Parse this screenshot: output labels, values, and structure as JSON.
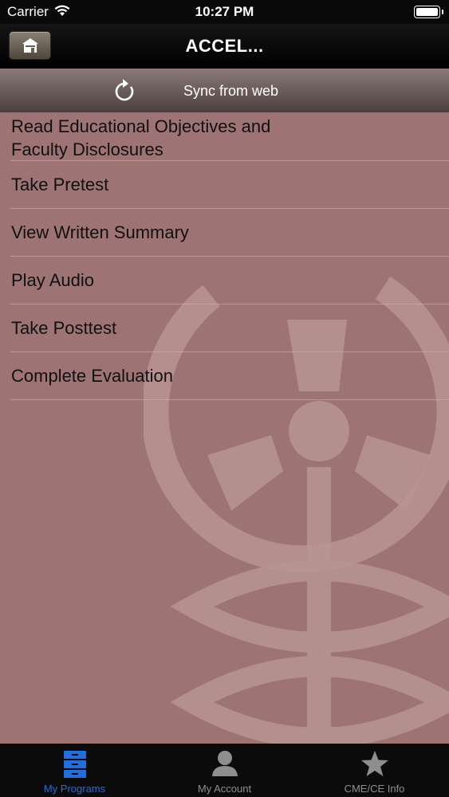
{
  "status_bar": {
    "carrier": "Carrier",
    "time": "10:27 PM"
  },
  "nav": {
    "title": "ACCEL...",
    "home_icon": "home-icon"
  },
  "sync": {
    "label": "Sync from web",
    "icon": "refresh-icon"
  },
  "menu": {
    "items": [
      {
        "label": "Read Educational Objectives and Faculty Disclosures"
      },
      {
        "label": "Take Pretest"
      },
      {
        "label": "View Written Summary"
      },
      {
        "label": "Play Audio"
      },
      {
        "label": "Take Posttest"
      },
      {
        "label": "Complete Evaluation"
      }
    ]
  },
  "tabs": [
    {
      "label": "My Programs",
      "icon": "cabinet-icon",
      "active": true
    },
    {
      "label": "My Account",
      "icon": "person-icon",
      "active": false
    },
    {
      "label": "CME/CE Info",
      "icon": "star-icon",
      "active": false
    }
  ],
  "colors": {
    "background": "#9d7373",
    "tab_active": "#1f6fe0",
    "tab_inactive": "#8e8e8e"
  }
}
